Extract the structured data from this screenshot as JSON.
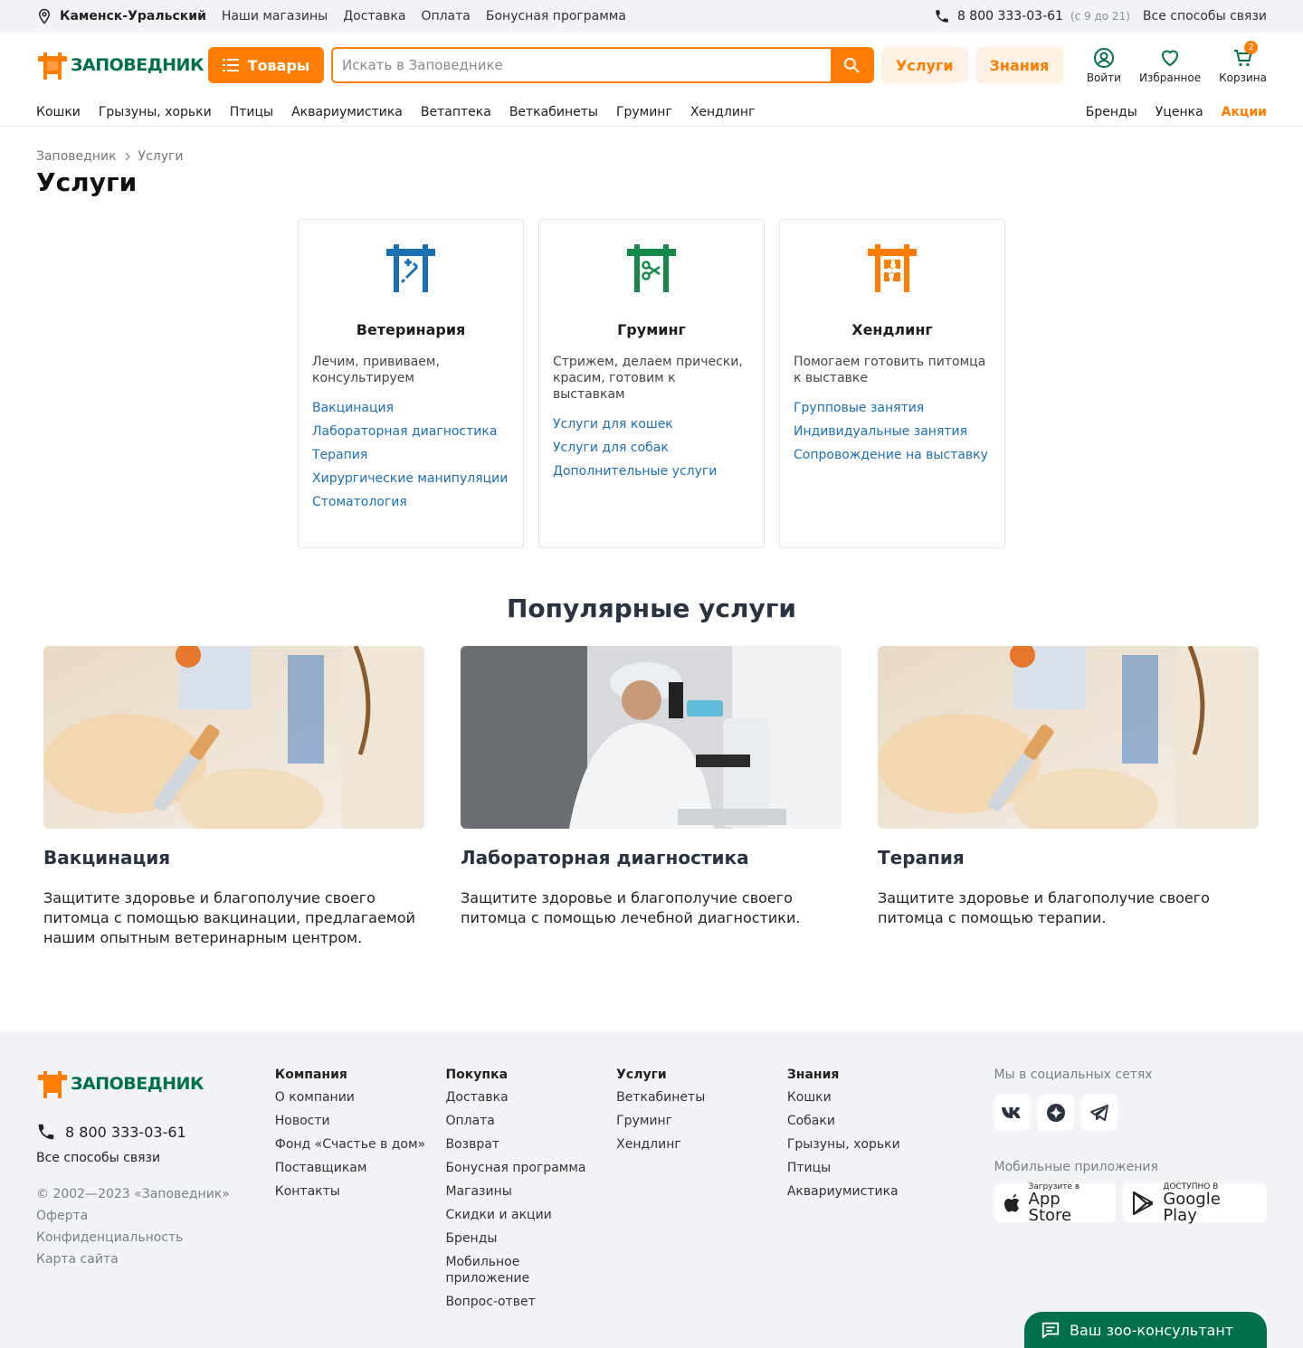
{
  "topbar": {
    "city": "Каменск-Уральский",
    "links": [
      "Наши магазины",
      "Доставка",
      "Оплата",
      "Бонусная программа"
    ],
    "phone": "8 800 333-03-61",
    "hours": "(с 9 до 21)",
    "all_contacts": "Все способы связи"
  },
  "header": {
    "logo_text": "ЗАПОВЕДНИК",
    "goods_button": "Товары",
    "search_placeholder": "Искать в Заповеднике",
    "services_button": "Услуги",
    "knowledge_button": "Знания",
    "login": "Войти",
    "favorites": "Избранное",
    "cart": "Корзина",
    "cart_count": "2"
  },
  "catnav": {
    "categories": [
      "Кошки",
      "Грызуны, хорьки",
      "Птицы",
      "Аквариумистика",
      "Ветаптека",
      "Веткабинеты",
      "Груминг",
      "Хендлинг"
    ],
    "brands": "Бренды",
    "markdown": "Уценка",
    "promo": "Акции"
  },
  "breadcrumbs": [
    "Заповедник",
    "Услуги"
  ],
  "page_title": "Услуги",
  "services": [
    {
      "title": "Ветеринария",
      "description": "Лечим, прививаем, консультируем",
      "color": "#1b6fb3",
      "links": [
        "Вакцинация",
        "Лабораторная диагностика",
        "Терапия",
        "Хирургические манипуляции",
        "Стоматология"
      ]
    },
    {
      "title": "Груминг",
      "description": "Стрижем, делаем прически, красим, готовим к выставкам",
      "color": "#138a4a",
      "links": [
        "Услуги для кошек",
        "Услуги для собак",
        "Дополнительные услуги"
      ]
    },
    {
      "title": "Хендлинг",
      "description": "Помогаем готовить питомца к выставке",
      "color": "#ff7d00",
      "links": [
        "Групповые занятия",
        "Индивидуальные занятия",
        "Сопровождение на выставку"
      ]
    }
  ],
  "popular": {
    "title": "Популярные услуги",
    "items": [
      {
        "title": "Вакцинация",
        "text": "Защитите здоровье и благополучие своего питомца с помощью вакцинации, предлагаемой нашим опытным ветеринарным центром."
      },
      {
        "title": "Лабораторная диагностика",
        "text": "Защитите здоровье и благополучие своего питомца с помощью лечебной диагностики."
      },
      {
        "title": "Терапия",
        "text": "Защитите здоровье и благополучие своего питомца с помощью терапии."
      }
    ]
  },
  "footer": {
    "logo_text": "ЗАПОВЕДНИК",
    "phone": "8 800 333-03-61",
    "all_contacts": "Все способы связи",
    "copyright": "© 2002—2023 «Заповедник»",
    "legal": [
      "Оферта",
      "Конфиденциальность",
      "Карта сайта"
    ],
    "columns": [
      {
        "title": "Компания",
        "items": [
          "О компании",
          "Новости",
          "Фонд «Счастье в дом»",
          "Поставщикам",
          "Контакты"
        ]
      },
      {
        "title": "Покупка",
        "items": [
          "Доставка",
          "Оплата",
          "Возврат",
          "Бонусная программа",
          "Магазины",
          "Скидки и акции",
          "Бренды",
          "Мобильное приложение",
          "Вопрос-ответ"
        ]
      },
      {
        "title": "Услуги",
        "items": [
          "Веткабинеты",
          "Груминг",
          "Хендлинг"
        ]
      },
      {
        "title": "Знания",
        "items": [
          "Кошки",
          "Собаки",
          "Грызуны, хорьки",
          "Птицы",
          "Аквариумистика"
        ]
      }
    ],
    "social_label": "Мы в социальных сетях",
    "apps_label": "Мобильные приложения",
    "appstore_small": "Загрузите в",
    "appstore_big": "App Store",
    "gplay_small": "ДОСТУПНО В",
    "gplay_big": "Google Play"
  },
  "consultant": "Ваш зоо-консультант",
  "colors": {
    "accent": "#ff7d00",
    "brand_green": "#00704a",
    "link": "#1b6fb3"
  }
}
